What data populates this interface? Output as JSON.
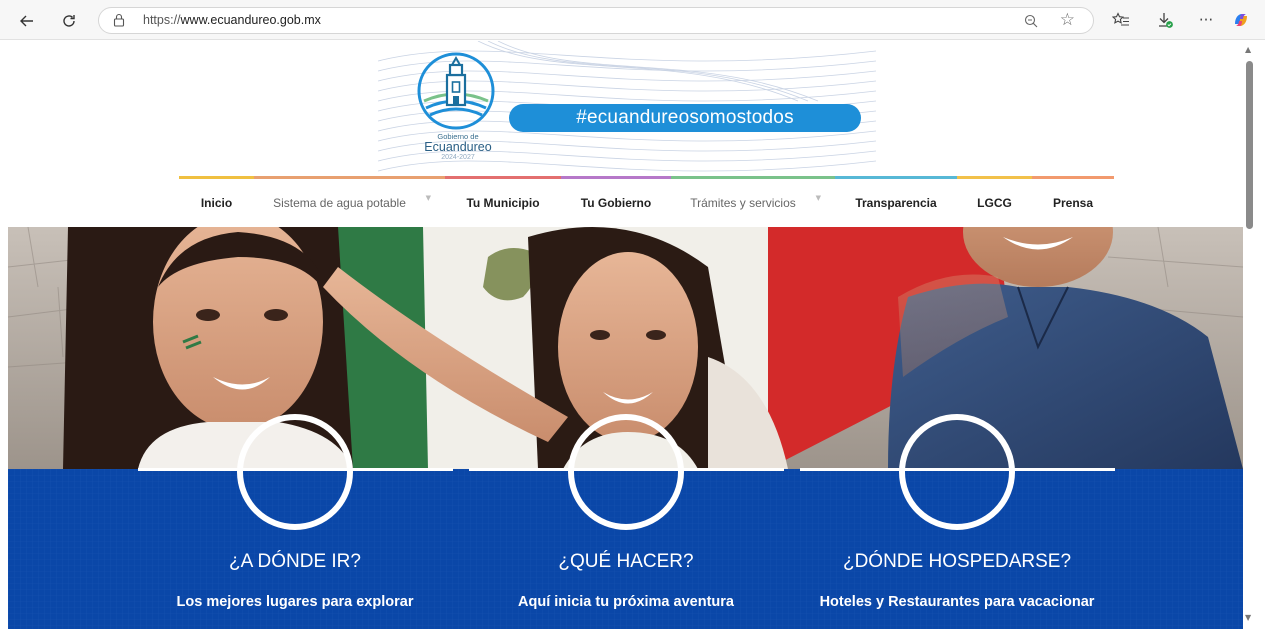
{
  "browser": {
    "url": "https://www.ecuandureo.gob.mx",
    "url_display_prefix": "https://",
    "url_display_host": "www.ecuandureo.gob.mx",
    "icons": [
      "back-icon",
      "refresh-icon",
      "lock-icon",
      "zoom-icon",
      "favorite-star-icon",
      "favorites-icon",
      "downloads-icon",
      "more-icon",
      "copilot-icon"
    ]
  },
  "header": {
    "logo_line1": "Gobierno de",
    "logo_line2": "Ecuandureo",
    "logo_line3": "2024-2027",
    "hashtag": "#ecuandureosomostodos"
  },
  "menu": {
    "items": [
      {
        "label": "Inicio",
        "color": "#f0c040"
      },
      {
        "label": "Sistema de agua potable",
        "color": "#e8a070"
      },
      {
        "label": "Tu Municipio",
        "color": "#e36f6f"
      },
      {
        "label": "Tu Gobierno",
        "color": "#b678c9"
      },
      {
        "label": "Trámites y servicios",
        "color": "#7ac28a"
      },
      {
        "label": "Transparencia",
        "color": "#57b8d6"
      },
      {
        "label": "LGCG",
        "color": "#f2c14a"
      },
      {
        "label": "Prensa",
        "color": "#f29a6e"
      }
    ]
  },
  "hero": {
    "image": "people-with-mexican-flag"
  },
  "cards": [
    {
      "title": "¿A DÓNDE IR?",
      "subtitle": "Los mejores lugares para explorar"
    },
    {
      "title": "¿QUÉ HACER?",
      "subtitle": "Aquí inicia tu próxima aventura"
    },
    {
      "title": "¿DÓNDE HOSPEDARSE?",
      "subtitle": "Hoteles y Restaurantes para vacacionar"
    }
  ],
  "colors": {
    "blue": "#0a47a8",
    "hashtag_blue": "#1e8fd8",
    "flag_green": "#2f7a45",
    "flag_red": "#d32a2a"
  }
}
